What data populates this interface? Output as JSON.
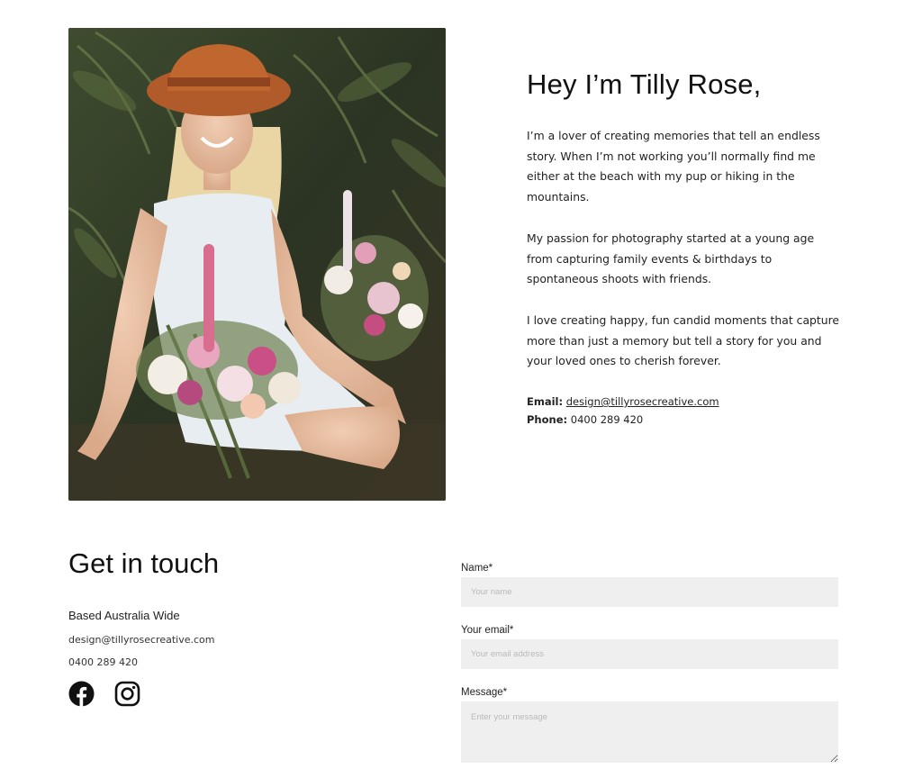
{
  "about": {
    "heading": "Hey I’m Tilly Rose,",
    "paragraphs": [
      "I’m a lover of creating memories that tell an endless story. When I’m not working you’ll normally find me either at the beach with my pup or hiking in the mountains.",
      "My passion for photography started at a young age from capturing family events & birthdays to spontaneous shoots with friends.",
      "I love creating happy, fun candid moments that capture more than just a memory but tell a story for you and your loved ones to cherish forever."
    ],
    "email_label": "Email:",
    "email": "design@tillyrosecreative.com",
    "phone_label": "Phone:",
    "phone": "0400 289 420"
  },
  "touch": {
    "heading": "Get in touch",
    "based": "Based Australia Wide",
    "email": "design@tillyrosecreative.com",
    "phone": "0400 289 420",
    "socials": [
      "facebook-icon",
      "instagram-icon"
    ]
  },
  "form": {
    "name_label": "Name*",
    "name_placeholder": "Your name",
    "email_label": "Your email*",
    "email_placeholder": "Your email address",
    "message_label": "Message*",
    "message_placeholder": "Enter your message"
  }
}
